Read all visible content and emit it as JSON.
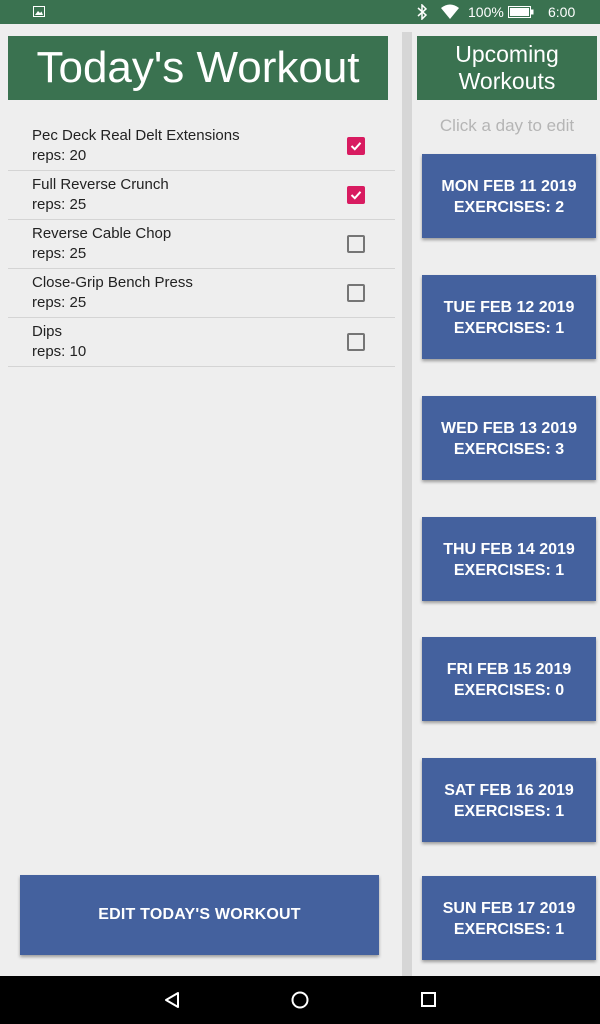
{
  "status_bar": {
    "battery_percent": "100%",
    "time": "6:00",
    "icons": [
      "image-notification-icon",
      "bluetooth-icon",
      "wifi-icon",
      "battery-icon"
    ],
    "background_color": "#3a7250"
  },
  "today": {
    "title": "Today's Workout",
    "exercises": [
      {
        "name": "Pec Deck Real Delt Extensions",
        "reps": "reps: 20",
        "checked": true
      },
      {
        "name": "Full Reverse Crunch",
        "reps": "reps: 25",
        "checked": true
      },
      {
        "name": "Reverse Cable Chop",
        "reps": "reps: 25",
        "checked": false
      },
      {
        "name": "Close-Grip Bench Press",
        "reps": "reps: 25",
        "checked": false
      },
      {
        "name": "Dips",
        "reps": "reps: 10",
        "checked": false
      }
    ],
    "edit_button_label": "EDIT TODAY'S WORKOUT"
  },
  "upcoming": {
    "title_line1": "Upcoming",
    "title_line2": "Workouts",
    "hint": "Click a day to edit",
    "days": [
      {
        "date": "MON FEB 11 2019",
        "exercises": "EXERCISES: 2"
      },
      {
        "date": "TUE FEB 12 2019",
        "exercises": "EXERCISES: 1"
      },
      {
        "date": "WED FEB 13 2019",
        "exercises": "EXERCISES: 3"
      },
      {
        "date": "THU FEB 14 2019",
        "exercises": "EXERCISES: 1"
      },
      {
        "date": "FRI FEB 15 2019",
        "exercises": "EXERCISES: 0"
      },
      {
        "date": "SAT FEB 16 2019",
        "exercises": "EXERCISES: 1"
      },
      {
        "date": "SUN FEB 17 2019",
        "exercises": "EXERCISES: 1"
      }
    ]
  },
  "colors": {
    "header_green": "#3a7250",
    "button_blue": "#44619e",
    "checkbox_checked": "#d81b60",
    "background": "#eeeeee"
  },
  "nav_bar": {
    "icons": [
      "back-icon",
      "home-icon",
      "recents-icon"
    ]
  }
}
